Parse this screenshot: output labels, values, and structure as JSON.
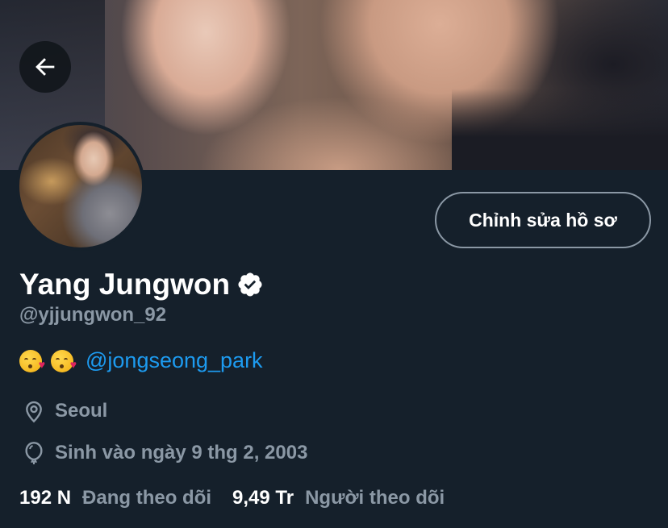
{
  "profile": {
    "display_name": "Yang Jungwon",
    "verified": true,
    "handle": "@yjjungwon_92",
    "bio_mention": "@jongseong_park",
    "bio_emoji": [
      "face-blowing-kiss",
      "face-blowing-kiss"
    ],
    "location": "Seoul",
    "birthday": "Sinh vào ngày 9 thg 2, 2003"
  },
  "actions": {
    "edit_profile_label": "Chỉnh sửa hồ sơ"
  },
  "stats": {
    "following_count": "192 N",
    "following_label": "Đang theo dõi",
    "followers_count": "9,49 Tr",
    "followers_label": "Người theo dõi"
  },
  "icons": {
    "back": "arrow-left-icon",
    "verified": "verified-badge-icon",
    "location": "location-pin-icon",
    "birthday": "balloon-icon"
  },
  "colors": {
    "background": "#15202b",
    "accent": "#1d9bf0",
    "secondary_text": "#8b98a5",
    "primary_text": "#ffffff"
  }
}
